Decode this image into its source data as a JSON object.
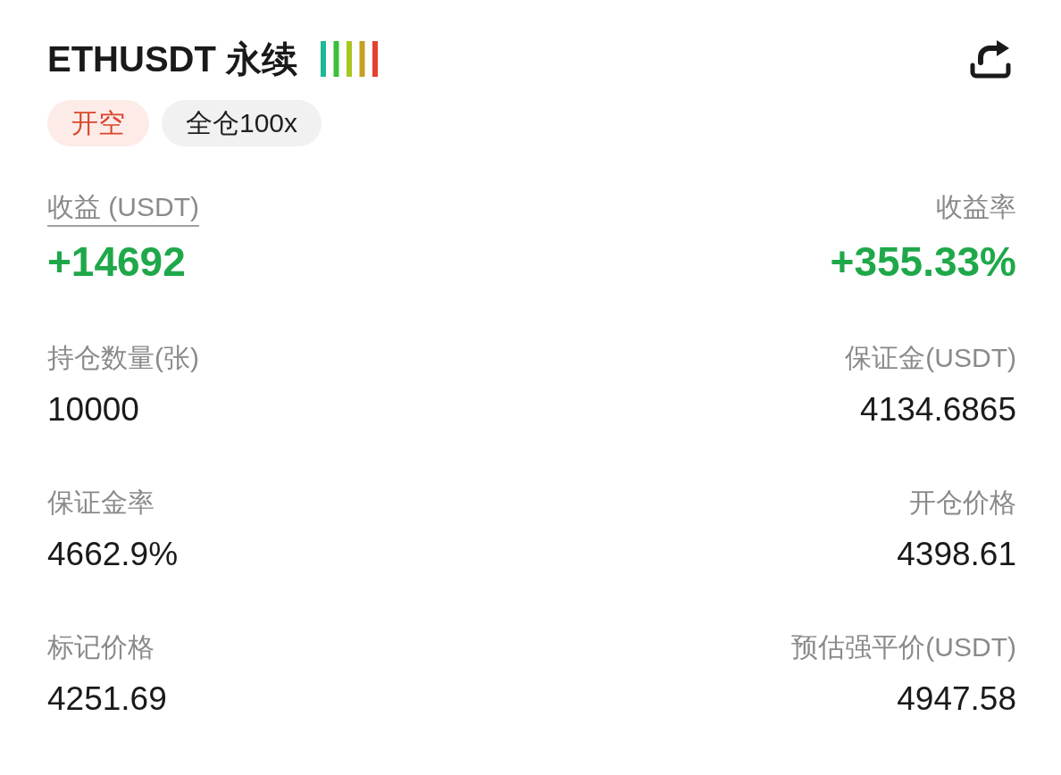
{
  "header": {
    "title": "ETHUSDT 永续"
  },
  "tags": [
    {
      "label": "开空",
      "kind": "side"
    },
    {
      "label": "全仓100x",
      "kind": "margin"
    }
  ],
  "summary": [
    {
      "label": "收益 (USDT)",
      "underlined": true,
      "value": "+14692",
      "positive": true
    },
    {
      "label": "收益率",
      "underlined": false,
      "value": "+355.33%",
      "positive": true
    }
  ],
  "fields": [
    {
      "label": "持仓数量(张)",
      "value": "10000"
    },
    {
      "label": "保证金(USDT)",
      "value": "4134.6865"
    },
    {
      "label": "保证金率",
      "value": "4662.9%"
    },
    {
      "label": "开仓价格",
      "value": "4398.61"
    },
    {
      "label": "标记价格",
      "value": "4251.69"
    },
    {
      "label": "预估强平价(USDT)",
      "value": "4947.58"
    }
  ]
}
